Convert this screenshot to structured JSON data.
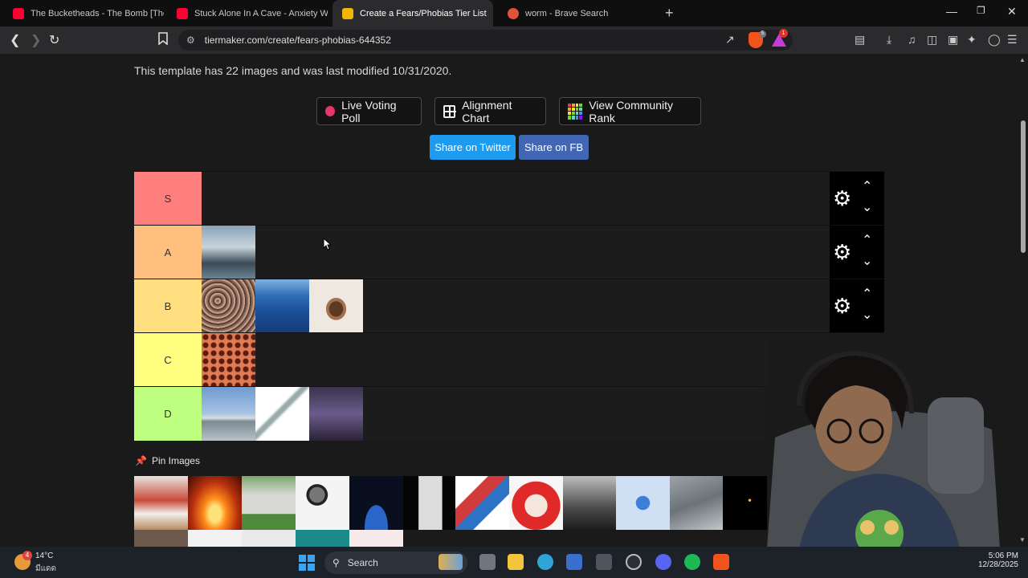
{
  "browser": {
    "tabs": [
      {
        "title": "The Bucketheads - The Bomb [These",
        "favicon_color": "#ff0033",
        "active": false
      },
      {
        "title": "Stuck Alone In A Cave - Anxiety Warr",
        "favicon_color": "#ff0033",
        "active": false
      },
      {
        "title": "Create a Fears/Phobias Tier List",
        "favicon_color": "#f2b705",
        "active": true,
        "close": "✕"
      },
      {
        "title": "worm - Brave Search",
        "favicon_color": "#e0533b",
        "active": false
      }
    ],
    "new_tab": "+",
    "url": "tiermaker.com/create/fears-phobias-644352",
    "brave_shield_count": "5",
    "rewards_badge": "1"
  },
  "page": {
    "info_text": "This template has 22 images and was last modified 10/31/2020.",
    "buttons": {
      "live_voting": "Live Voting Poll",
      "alignment_chart": "Alignment Chart",
      "community_rank": "View Community Rank"
    },
    "share": {
      "twitter": "Share on Twitter",
      "facebook": "Share on FB",
      "twitter_color": "#1d9bf0",
      "facebook_color": "#4267b2"
    },
    "tiers": [
      {
        "label": "S",
        "color": "#ff7f7f",
        "images": []
      },
      {
        "label": "A",
        "color": "#ffbf7f",
        "images": [
          "shark"
        ]
      },
      {
        "label": "B",
        "color": "#ffdf7f",
        "images": [
          "crowd",
          "ocean",
          "spider"
        ]
      },
      {
        "label": "C",
        "color": "#ffff7f",
        "images": [
          "holes"
        ]
      },
      {
        "label": "D",
        "color": "#bfff7f",
        "images": [
          "airplane",
          "syringe",
          "lightning"
        ]
      }
    ],
    "pin_images_label": "Pin Images",
    "pool_images": [
      "puppet",
      "fire",
      "grave",
      "microphone",
      "asteroid",
      "window",
      "knot",
      "clown",
      "man-portrait",
      "virus",
      "heights",
      "candle-dark",
      "partial-1",
      "partial-2",
      "partial-3",
      "partial-4",
      "partial-5"
    ]
  },
  "taskbar": {
    "weather_temp": "14°C",
    "weather_desc": "มีแดด",
    "weather_badge": "4",
    "search_label": "Search",
    "time": "5:06 PM",
    "date": "12/28/2025"
  }
}
